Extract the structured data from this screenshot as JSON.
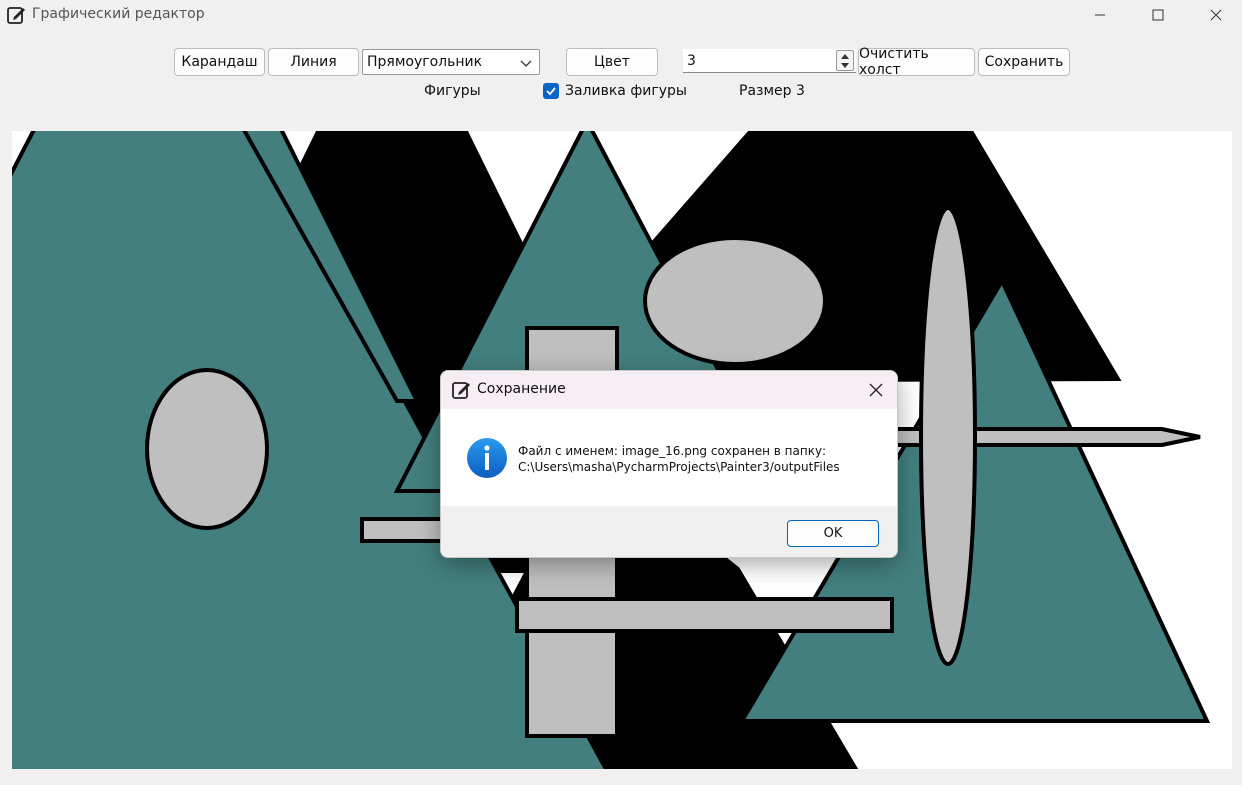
{
  "window": {
    "title": "Графический редактор",
    "app_icon": "edit-icon",
    "controls": [
      "minimize-icon",
      "maximize-icon",
      "close-icon"
    ]
  },
  "toolbar": {
    "pencil_label": "Карандаш",
    "line_label": "Линия",
    "shape_select": {
      "value": "Прямоугольник"
    },
    "color_label": "Цвет",
    "size_value": "3",
    "clear_label": "Очистить холст",
    "save_label": "Сохранить",
    "figures_label": "Фигуры",
    "fill_label": "Заливка фигуры",
    "fill_checked": true,
    "size_label": "Размер 3"
  },
  "canvas": {
    "colors": {
      "teal": "#437f7f",
      "gray": "#bfbfbf",
      "black": "#000000",
      "white": "#ffffff"
    }
  },
  "dialog": {
    "title": "Сохранение",
    "icon": "info-icon",
    "message_line1": "Файл с именем: image_16.png сохранен в папку:",
    "message_line2": "C:\\Users\\masha\\PycharmProjects\\Painter3/outputFiles",
    "ok_label": "OK"
  },
  "colors": {
    "accent": "#0a64c8",
    "info_blue": "#1a7fd8"
  }
}
